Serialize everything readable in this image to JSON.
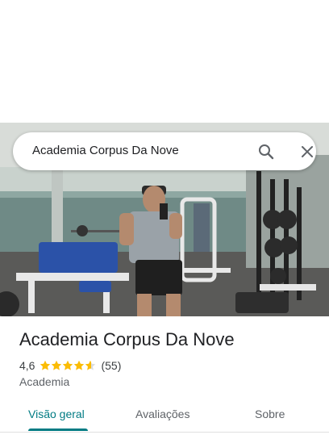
{
  "search": {
    "query": "Academia Corpus Da Nove"
  },
  "place": {
    "name": "Academia Corpus Da Nove",
    "rating": "4,6",
    "stars": 4.6,
    "reviews": "(55)",
    "category": "Academia"
  },
  "tabs": [
    {
      "label": "Visão geral",
      "active": true
    },
    {
      "label": "Avaliações",
      "active": false
    },
    {
      "label": "Sobre",
      "active": false
    }
  ],
  "colors": {
    "accent": "#007b83",
    "star": "#fbbc04",
    "star_empty": "#dadce0"
  },
  "icons": {
    "search": "search-icon",
    "close": "close-icon"
  }
}
